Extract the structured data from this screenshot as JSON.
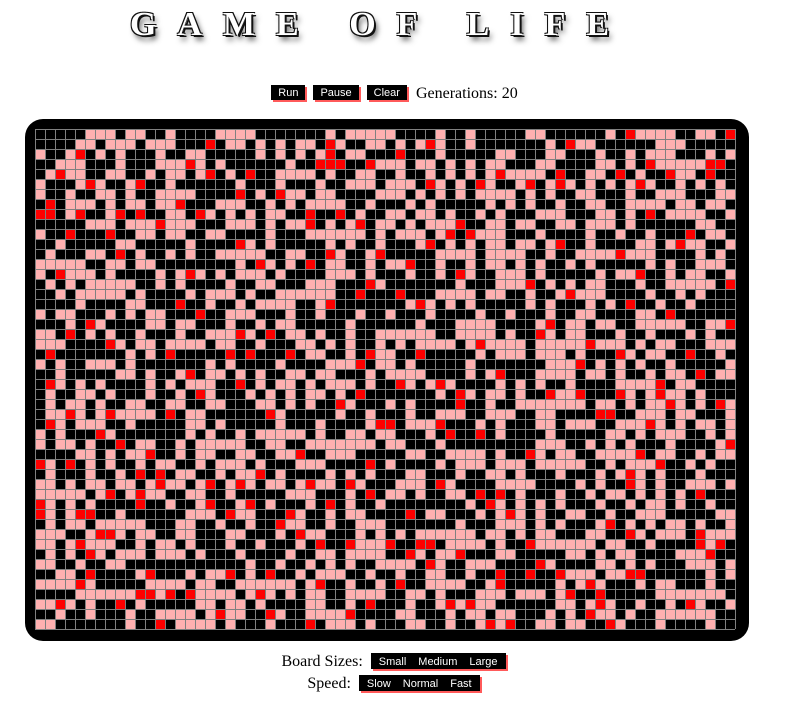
{
  "title": "GAME OF LIFE",
  "controls": {
    "run_label": "Run",
    "pause_label": "Pause",
    "clear_label": "Clear",
    "generations_label": "Generations: 20"
  },
  "board": {
    "cols": 70,
    "rows": 50,
    "colors": {
      "background": "#000000",
      "grid": "#808080",
      "young_cell": "#ff0000",
      "old_cell": "#ffb0b0"
    }
  },
  "board_sizes": {
    "label": "Board Sizes:",
    "options": [
      "Small",
      "Medium",
      "Large"
    ]
  },
  "speed": {
    "label": "Speed:",
    "options": [
      "Slow",
      "Normal",
      "Fast"
    ]
  }
}
